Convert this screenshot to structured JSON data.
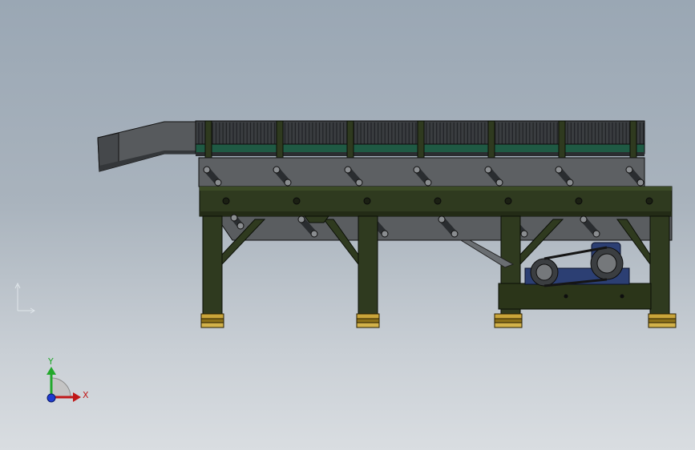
{
  "view": {
    "background_top": "#9aa7b4",
    "background_bottom": "#d9dde1"
  },
  "model": {
    "frame_color": "#2f3a1f",
    "frame_edge": "#0b0f07",
    "trough_color": "#5a5d60",
    "belt_color": "#1f5a44",
    "foot_color": "#c9a53a",
    "motor_color": "#2c3f73"
  },
  "triad": {
    "x_label": "X",
    "y_label": "Y",
    "x_color": "#c01818",
    "y_color": "#22a82b",
    "z_color": "#1e3bd0"
  }
}
